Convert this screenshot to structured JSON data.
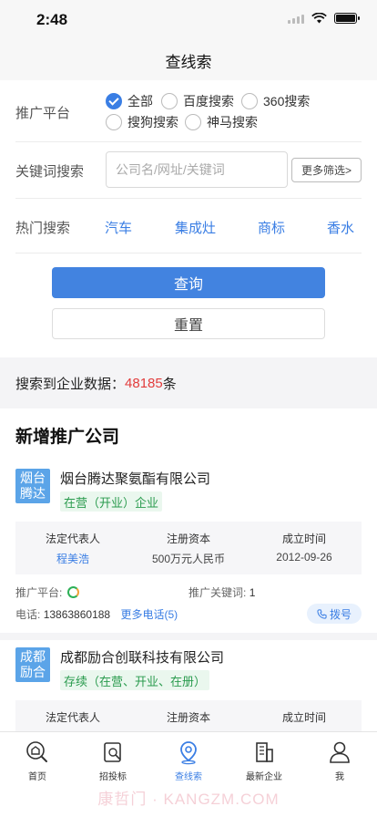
{
  "status": {
    "time": "2:48"
  },
  "nav": {
    "title": "查线索"
  },
  "filters": {
    "platform_label": "推广平台",
    "platforms": [
      {
        "label": "全部",
        "checked": true
      },
      {
        "label": "百度搜索",
        "checked": false
      },
      {
        "label": "360搜索",
        "checked": false
      },
      {
        "label": "搜狗搜索",
        "checked": false
      },
      {
        "label": "神马搜索",
        "checked": false
      }
    ],
    "keyword_label": "关键词搜索",
    "keyword_placeholder": "公司名/网址/关键词",
    "more_filter_label": "更多筛选>",
    "hot_label": "热门搜索",
    "hot_terms": [
      "汽车",
      "集成灶",
      "商标",
      "香水"
    ],
    "query_button": "查询",
    "reset_button": "重置"
  },
  "result": {
    "prefix": "搜索到企业数据：",
    "count": "48185",
    "suffix": "条"
  },
  "section": {
    "title": "新增推广公司"
  },
  "companies": [
    {
      "logo_text": "烟台腾达",
      "name": "烟台腾达聚氨酯有限公司",
      "status": "在营（开业）企业",
      "legal_rep_label": "法定代表人",
      "legal_rep": "程美浩",
      "capital_label": "注册资本",
      "capital": "500万元人民币",
      "founded_label": "成立时间",
      "founded": "2012-09-26",
      "platform_label": "推广平台:",
      "keyword_label": "推广关键词:",
      "keyword_count": "1",
      "phone_label": "电话:",
      "phone": "13863860188",
      "more_phones": "更多电话(5)",
      "call_label": "拨号"
    },
    {
      "logo_text": "成都励合",
      "name": "成都励合创联科技有限公司",
      "status": "存续（在营、开业、在册）",
      "legal_rep_label": "法定代表人",
      "capital_label": "注册资本",
      "founded_label": "成立时间"
    }
  ],
  "tabs": [
    {
      "label": "首页",
      "icon": "home-search-icon",
      "active": false
    },
    {
      "label": "招投标",
      "icon": "bidding-icon",
      "active": false
    },
    {
      "label": "查线索",
      "icon": "location-pin-icon",
      "active": true
    },
    {
      "label": "最新企业",
      "icon": "building-icon",
      "active": false
    },
    {
      "label": "我",
      "icon": "user-icon",
      "active": false
    }
  ],
  "watermark": "康哲门 · KANGZM.COM",
  "colors": {
    "accent": "#3a7ee4",
    "count": "#e23c3c",
    "tag_green": "#2a9b4e",
    "logo": "#5ba4e8"
  }
}
